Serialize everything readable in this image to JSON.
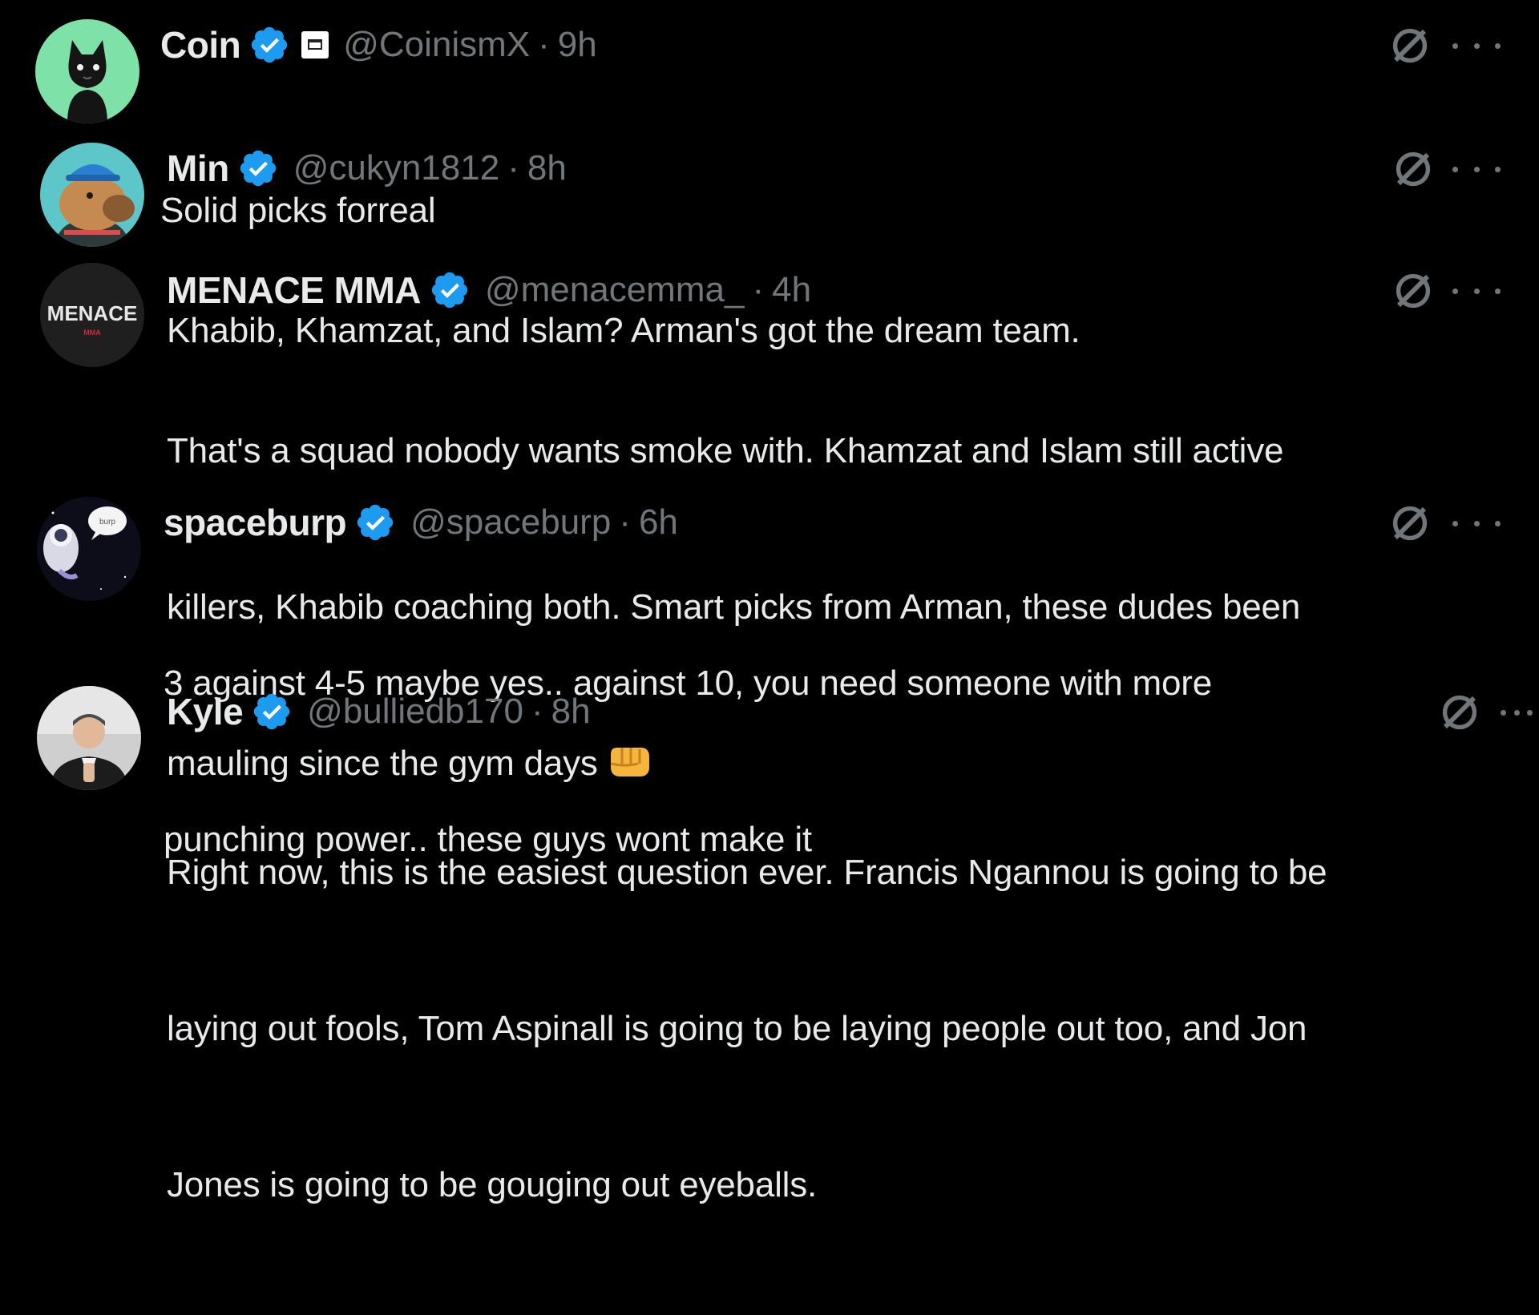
{
  "tweets": [
    {
      "name": "Coin",
      "handle": "@CoinismX",
      "separator": "·",
      "time": "9h",
      "lines": [
        "Solid picks forreal"
      ],
      "avatar_icon": "black-cat-avatar-icon",
      "avatar_bg": "#7ee2a8"
    },
    {
      "name": "Min",
      "handle": "@cukyn1812",
      "separator": "·",
      "time": "8h",
      "lines": [
        "Khabib, Khamzat, and Islam? Arman's got the dream team."
      ],
      "avatar_icon": "capybara-avatar-icon",
      "avatar_bg": "#5cc6c9"
    },
    {
      "name": "MENACE MMA",
      "handle": "@menacemma_",
      "separator": "·",
      "time": "4h",
      "lines": [
        "That's a squad nobody wants smoke with. Khamzat and Islam still active",
        "killers, Khabib coaching both. Smart picks from Arman, these dudes been",
        "mauling since the gym days"
      ],
      "emoji": "oncoming-fist-emoji",
      "avatar_logo": "MENACE",
      "avatar_sub": "MMA",
      "avatar_bg": "#1f1f1f"
    },
    {
      "name": "spaceburp",
      "handle": "@spaceburp",
      "separator": "·",
      "time": "6h",
      "lines": [
        "3 against 4-5 maybe yes.. against 10, you need someone with more",
        "punching power.. these guys wont make it"
      ],
      "avatar_icon": "astronaut-avatar-icon",
      "avatar_bg": "#0d0d1a",
      "avatar_bubble": "burp"
    },
    {
      "name": "Kyle",
      "handle": "@bulliedb170",
      "separator": "·",
      "time": "8h",
      "lines": [
        "Right now, this is the easiest question ever. Francis Ngannou is going to be",
        "laying out fools, Tom Aspinall is going to be laying people out too, and Jon",
        "Jones is going to be gouging out eyeballs."
      ],
      "avatar_icon": "man-in-suit-avatar-icon",
      "avatar_bg": "#cfcfcf"
    }
  ],
  "colors": {
    "background": "#000000",
    "text": "#e7e9ea",
    "muted": "#71767b",
    "verified": "#1d9bf0"
  }
}
